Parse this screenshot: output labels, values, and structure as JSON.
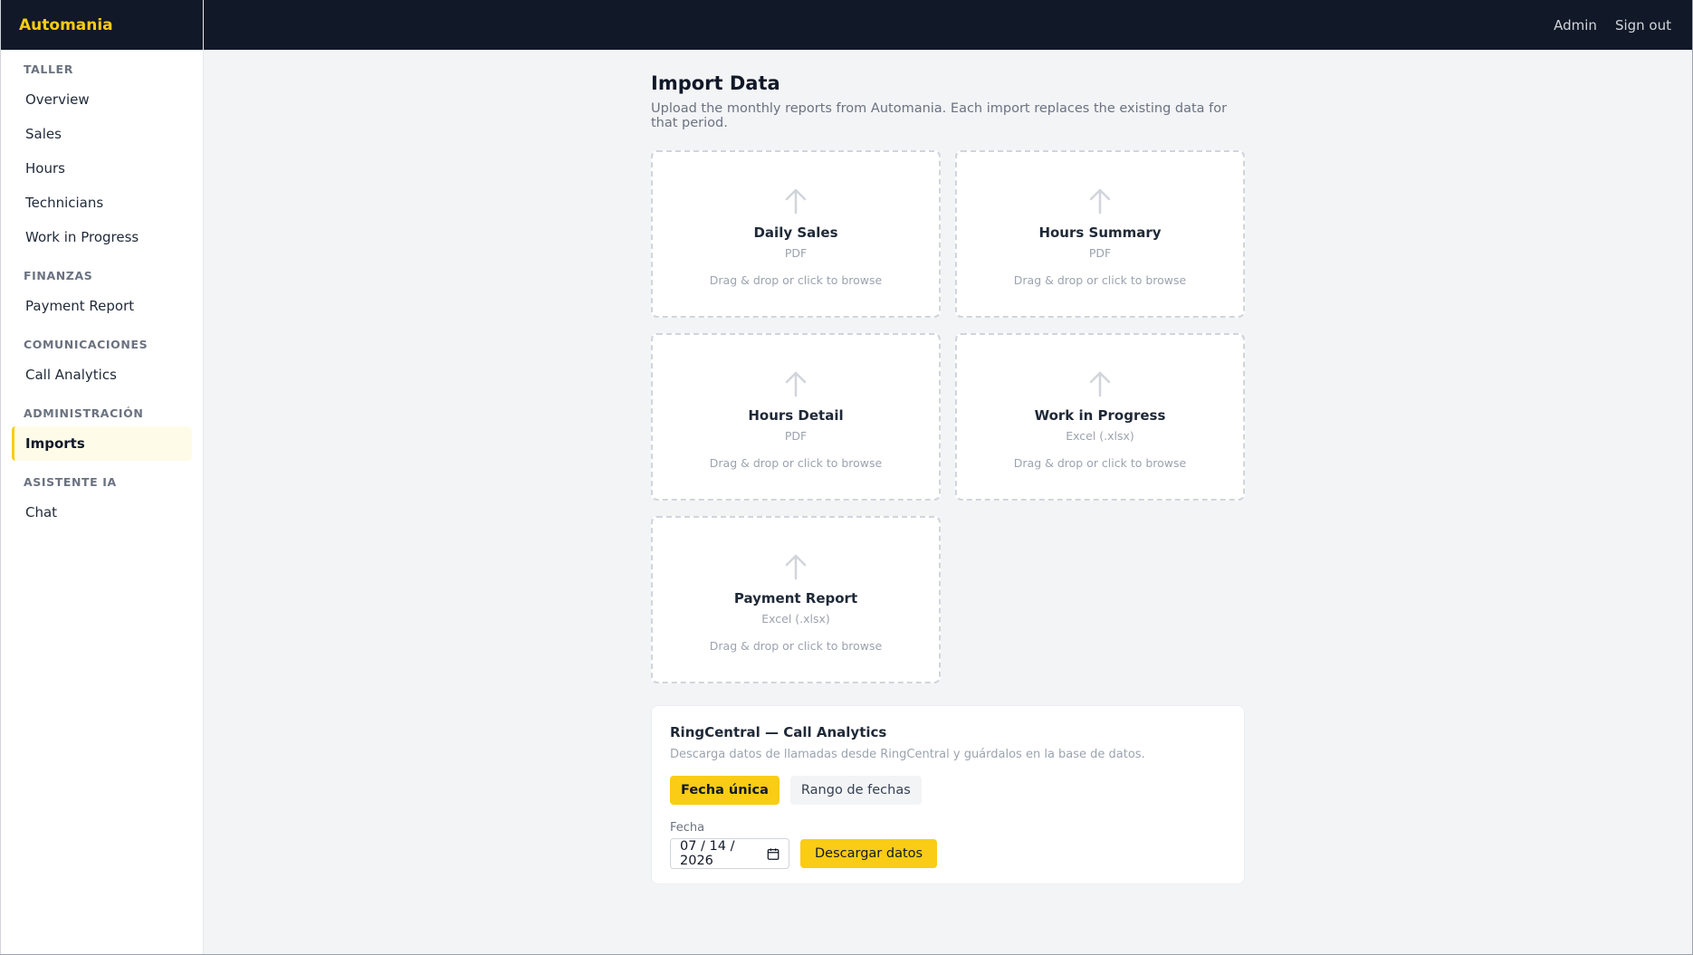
{
  "app": {
    "brand": "Automania"
  },
  "topbar": {
    "user": "Admin",
    "signout": "Sign out"
  },
  "sidebar": {
    "sections": [
      {
        "title": "TALLER",
        "items": [
          "Overview",
          "Sales",
          "Hours",
          "Technicians",
          "Work in Progress"
        ]
      },
      {
        "title": "FINANZAS",
        "items": [
          "Payment Report"
        ]
      },
      {
        "title": "COMUNICACIONES",
        "items": [
          "Call Analytics"
        ]
      },
      {
        "title": "ADMINISTRACIÓN",
        "items": [
          "Imports"
        ]
      },
      {
        "title": "ASISTENTE IA",
        "items": [
          "Chat"
        ]
      }
    ],
    "active": "Imports"
  },
  "page": {
    "title": "Import Data",
    "description": "Upload the monthly reports from Automania. Each import replaces the existing data for that period."
  },
  "uploads": [
    {
      "title": "Daily Sales",
      "type": "PDF",
      "hint": "Drag & drop or click to browse"
    },
    {
      "title": "Hours Summary",
      "type": "PDF",
      "hint": "Drag & drop or click to browse"
    },
    {
      "title": "Hours Detail",
      "type": "PDF",
      "hint": "Drag & drop or click to browse"
    },
    {
      "title": "Work in Progress",
      "type": "Excel (.xlsx)",
      "hint": "Drag & drop or click to browse"
    },
    {
      "title": "Payment Report",
      "type": "Excel (.xlsx)",
      "hint": "Drag & drop or click to browse"
    }
  ],
  "ringcentral": {
    "title": "RingCentral — Call Analytics",
    "description": "Descarga datos de llamadas desde RingCentral y guárdalos en la base de datos.",
    "mode_single": "Fecha única",
    "mode_range": "Rango de fechas",
    "date_label": "Fecha",
    "date_value": "07 / 14 / 2026",
    "download_label": "Descargar datos"
  },
  "colors": {
    "accent": "#facc15",
    "dark": "#111827"
  },
  "icons": {
    "upload": "arrow-up-icon",
    "calendar": "calendar-icon"
  }
}
